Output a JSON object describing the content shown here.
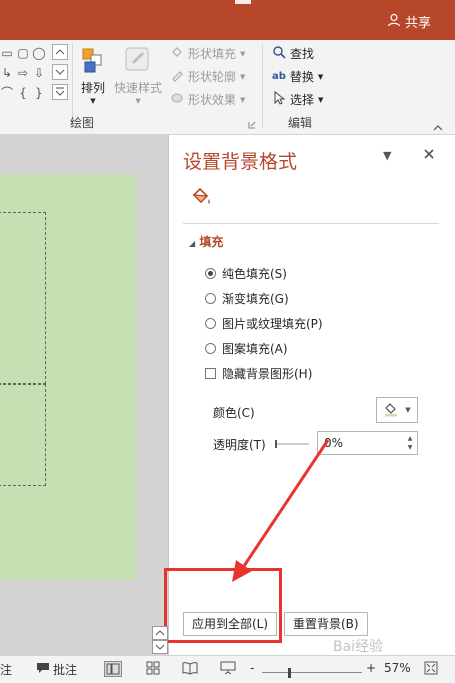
{
  "title_bar": {
    "share_label": "共享"
  },
  "ribbon": {
    "drawing_group_label": "绘图",
    "editing_group_label": "编辑",
    "arrange_label": "排列",
    "quick_styles_label": "快速样式",
    "shape_fill_label": "形状填充",
    "shape_outline_label": "形状轮廓",
    "shape_effects_label": "形状效果",
    "find_label": "查找",
    "replace_label": "替换",
    "select_label": "选择"
  },
  "pane": {
    "title": "设置背景格式",
    "section_fill": "填充",
    "options": [
      {
        "label": "纯色填充(S)",
        "checked": true
      },
      {
        "label": "渐变填充(G)",
        "checked": false
      },
      {
        "label": "图片或纹理填充(P)",
        "checked": false
      },
      {
        "label": "图案填充(A)",
        "checked": false
      }
    ],
    "hide_bg_label": "隐藏背景图形(H)",
    "color_label": "颜色(C)",
    "transparency_label": "透明度(T)",
    "transparency_value": "0%",
    "apply_all_label": "应用到全部(L)",
    "reset_bg_label": "重置背景(B)"
  },
  "status_bar": {
    "notes_label": "注",
    "comments_label": "批注",
    "zoom_minus": "-",
    "zoom_plus": "+",
    "zoom_level": "57%"
  },
  "colors": {
    "accent": "#b7472a",
    "slide_fill": "#c6e0b4",
    "highlight": "#e8342f"
  }
}
